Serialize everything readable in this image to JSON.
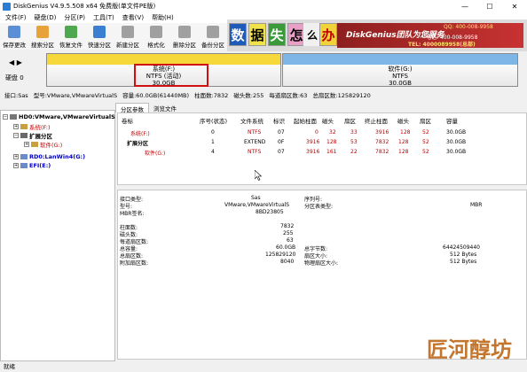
{
  "window": {
    "title": "DiskGenius V4.9.5.508 x64 免费版(单文件PE版)",
    "min": "—",
    "max": "☐",
    "close": "✕"
  },
  "menu": [
    "文件(F)",
    "硬盘(D)",
    "分区(P)",
    "工具(T)",
    "查看(V)",
    "帮助(H)"
  ],
  "toolbar": [
    {
      "label": "保存更改",
      "color": "#5a8fd8"
    },
    {
      "label": "搜索分区",
      "color": "#e8a23a"
    },
    {
      "label": "恢复文件",
      "color": "#4fa84f"
    },
    {
      "label": "快速分区",
      "color": "#3a7fd0"
    },
    {
      "label": "新建分区",
      "color": "#8a8a8a"
    },
    {
      "label": "格式化",
      "color": "#8a8a8a"
    },
    {
      "label": "删除分区",
      "color": "#8a8a8a"
    },
    {
      "label": "备份分区",
      "color": "#8a8a8a"
    }
  ],
  "banner": {
    "chars": [
      "数",
      "据",
      "失",
      "怎",
      "么",
      "办"
    ],
    "team": "DiskGenius团队为您服务",
    "qq": "QQ: 400-008-9958",
    "phone": "电话: 400-008-9958",
    "tel": "TEL: 4000089958(总部)"
  },
  "diskbar": {
    "disk_label": "硬盘 0",
    "nav": "◀ ▶",
    "partitions": [
      {
        "line1": "系统(F:)",
        "line2": "NTFS (活动)",
        "line3": "30.0GB"
      },
      {
        "line1": "软件(G:)",
        "line2": "NTFS",
        "line3": "30.0GB"
      }
    ]
  },
  "infobar": [
    "接口:Sas",
    "型号:VMware,VMwareVirtualS",
    "容量:60.0GB(61440MB)",
    "柱面数:7832",
    "磁头数:255",
    "每道扇区数:63",
    "总扇区数:125829120"
  ],
  "tree": [
    {
      "text": "HD0:VMware,VMwareVirtualS",
      "exp": "−",
      "color": "#000"
    },
    {
      "text": "系统(F:)",
      "exp": "+",
      "color": "#c00000"
    },
    {
      "text": "扩展分区",
      "exp": "−",
      "color": "#000"
    },
    {
      "text": "软件(G:)",
      "exp": "+",
      "color": "#c00000"
    },
    {
      "text": "RD0:LanWin4(G:)",
      "exp": "+",
      "color": "#0000c0"
    },
    {
      "text": "EFI(E:)",
      "exp": "+",
      "color": "#0000c0"
    }
  ],
  "tabs": [
    "分区参数",
    "浏览文件"
  ],
  "table": {
    "headers": [
      "卷标",
      "序号(状态)",
      "文件系统",
      "标识",
      "起始柱面",
      "磁头",
      "扇区",
      "终止柱面",
      "磁头",
      "扇区",
      "容量"
    ],
    "rows": [
      [
        "系统(F:)",
        "0",
        "NTFS",
        "07",
        "0",
        "32",
        "33",
        "3916",
        "128",
        "52",
        "30.0GB"
      ],
      [
        "扩展分区",
        "1",
        "EXTEND",
        "0F",
        "3916",
        "128",
        "53",
        "7832",
        "128",
        "52",
        "30.0GB"
      ],
      [
        "软件(G:)",
        "4",
        "NTFS",
        "07",
        "3916",
        "161",
        "22",
        "7832",
        "128",
        "52",
        "30.0GB"
      ]
    ]
  },
  "details": {
    "left": [
      {
        "label": "接口类型:",
        "value": "Sas"
      },
      {
        "label": "型号:",
        "value": "VMware,VMwareVirtualS"
      },
      {
        "label": "MBR签名:",
        "value": "8BD23805"
      },
      {
        "label": "柱面数:",
        "value": "7832"
      },
      {
        "label": "磁头数:",
        "value": "255"
      },
      {
        "label": "每道扇区数:",
        "value": "63"
      },
      {
        "label": "总容量:",
        "value": "60.0GB"
      },
      {
        "label": "总扇区数:",
        "value": "125829120"
      },
      {
        "label": "附加扇区数:",
        "value": "8040"
      }
    ],
    "right": [
      {
        "label": "序列号:",
        "value": ""
      },
      {
        "label": "分区表类型:",
        "value": "MBR"
      },
      {
        "label": "总字节数:",
        "value": "64424509440"
      },
      {
        "label": "扇区大小:",
        "value": "512 Bytes"
      },
      {
        "label": "物理扇区大小:",
        "value": "512 Bytes"
      }
    ]
  },
  "status": "就绪",
  "watermark": "匠河醇坊"
}
